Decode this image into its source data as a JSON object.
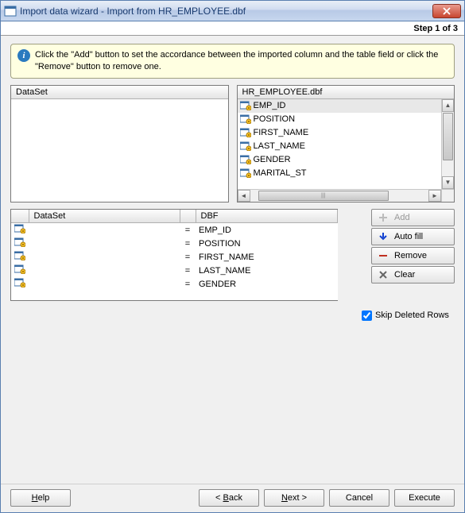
{
  "window": {
    "title": "Import data wizard - Import from HR_EMPLOYEE.dbf",
    "step_label": "Step 1 of 3"
  },
  "info": {
    "text": "Click the \"Add\" button to set the accordance between the imported column and the table field or click the \"Remove\" button to remove one."
  },
  "left_panel": {
    "header": "DataSet"
  },
  "right_panel": {
    "header": "HR_EMPLOYEE.dbf",
    "columns": [
      "EMP_ID",
      "POSITION",
      "FIRST_NAME",
      "LAST_NAME",
      "GENDER",
      "MARITAL_ST"
    ],
    "selected_index": 0
  },
  "mapping": {
    "header_dataset": "DataSet",
    "header_dbf": "DBF",
    "rows": [
      {
        "dbf": "EMP_ID"
      },
      {
        "dbf": "POSITION"
      },
      {
        "dbf": "FIRST_NAME"
      },
      {
        "dbf": "LAST_NAME"
      },
      {
        "dbf": "GENDER"
      }
    ]
  },
  "actions": {
    "add": "Add",
    "autofill": "Auto fill",
    "remove": "Remove",
    "clear": "Clear"
  },
  "options": {
    "skip_deleted_label": "Skip Deleted Rows",
    "skip_deleted_checked": true
  },
  "buttons": {
    "help": "Help",
    "back": "< Back",
    "next": "Next >",
    "cancel": "Cancel",
    "execute": "Execute"
  }
}
